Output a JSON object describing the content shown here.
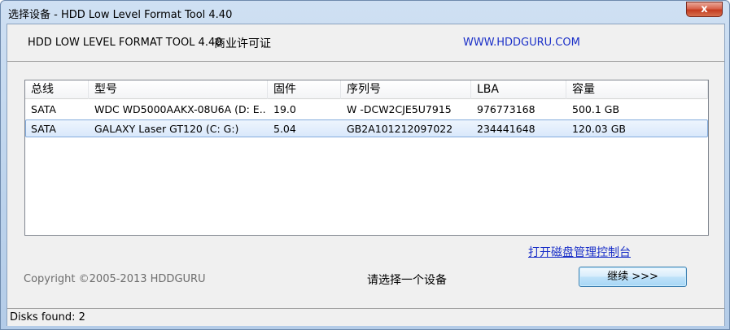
{
  "window": {
    "title": "选择设备 - HDD Low Level Format Tool 4.40",
    "close_glyph": "x"
  },
  "header": {
    "title": "HDD LOW LEVEL FORMAT TOOL 4.40",
    "subtitle": "商业许可证",
    "website": "WWW.HDDGURU.COM"
  },
  "device_list": {
    "columns": [
      "总线",
      "型号",
      "固件",
      "序列号",
      "LBA",
      "容量"
    ],
    "rows": [
      {
        "bus": "SATA",
        "model": "WDC WD5000AAKX-08U6A (D: E...",
        "firmware": "19.0",
        "serial": "W -DCW2CJE5U7915",
        "lba": "976773168",
        "capacity": "500.1 GB",
        "selected": false
      },
      {
        "bus": "SATA",
        "model": "GALAXY Laser GT120 (C: G:)",
        "firmware": "5.04",
        "serial": "GB2A101212097022",
        "lba": "234441648",
        "capacity": "120.03 GB",
        "selected": true
      }
    ]
  },
  "footer": {
    "disk_management_link": "打开磁盘管理控制台",
    "copyright": "Copyright ©2005-2013 HDDGURU",
    "prompt": "请选择一个设备",
    "continue_label": "继续 >>>"
  },
  "status": {
    "disks_found": "Disks found: 2"
  },
  "colors": {
    "link": "#1a2fc8",
    "selection_border": "#84acdd",
    "close_button": "#c43b20"
  }
}
